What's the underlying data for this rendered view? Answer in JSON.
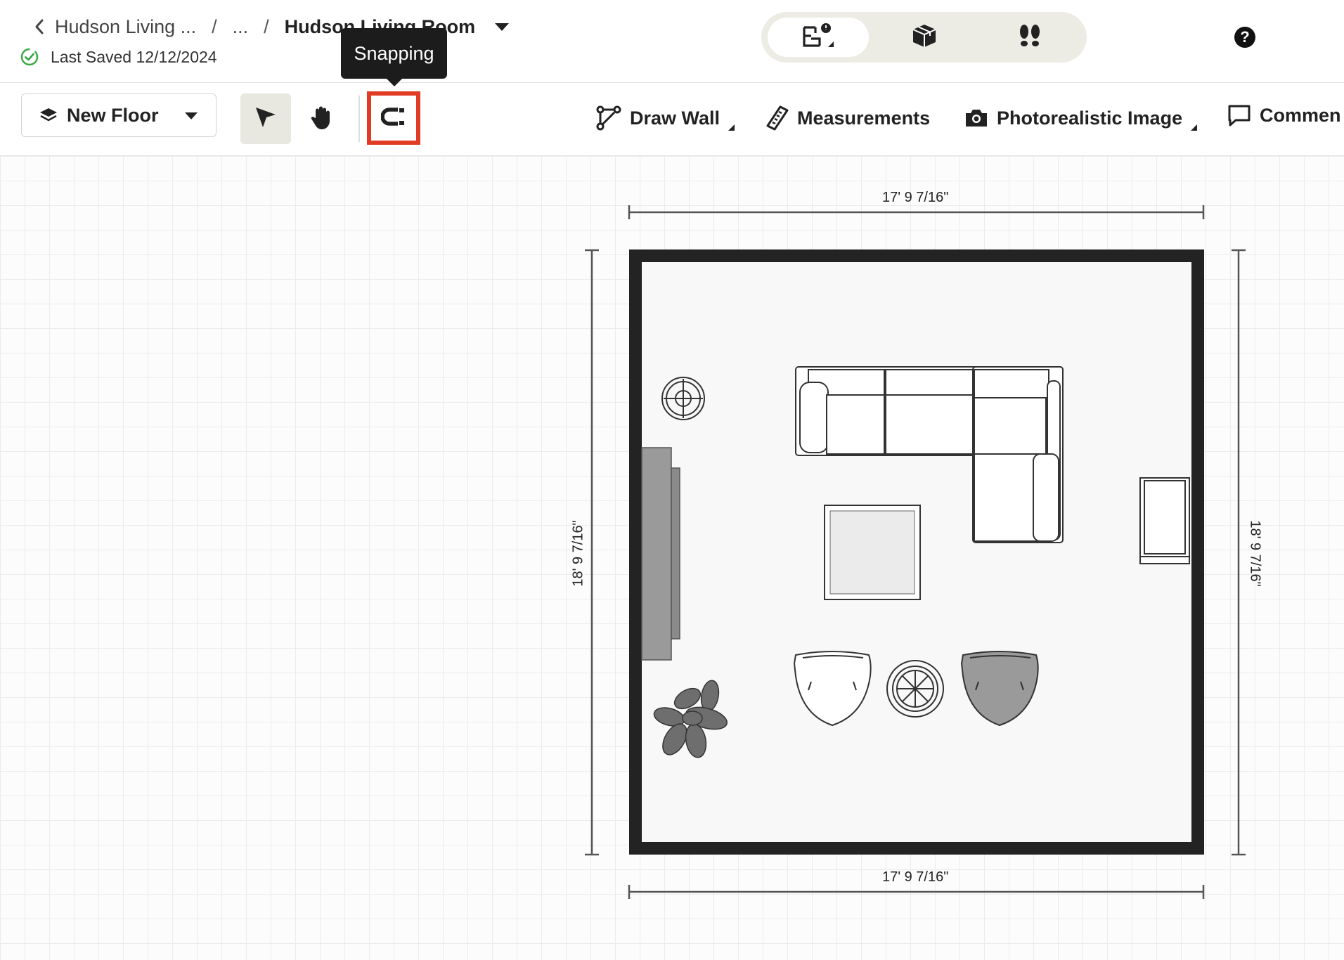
{
  "header": {
    "breadcrumb": {
      "parent": "Hudson Living ...",
      "ellipsis": "...",
      "separator": "/",
      "current": "Hudson Living Room"
    },
    "save_status": "Last Saved 12/12/2024",
    "view_modes": [
      {
        "name": "floorplan-2d-icon",
        "active": true
      },
      {
        "name": "3d-box-icon",
        "active": false
      },
      {
        "name": "walkthrough-footprints-icon",
        "active": false
      }
    ],
    "help_label": "?"
  },
  "toolbar": {
    "floor_select_label": "New Floor",
    "draw_wall_label": "Draw Wall",
    "measurements_label": "Measurements",
    "photorealistic_label": "Photorealistic Image",
    "comments_label": "Commen",
    "tooltip_text": "Snapping"
  },
  "floorplan": {
    "dim_top": "17' 9 7/16\"",
    "dim_bottom": "17' 9 7/16\"",
    "dim_left": "18' 9 7/16\"",
    "dim_right": "18' 9 7/16\""
  },
  "colors": {
    "highlight": "#e23b24",
    "wall": "#232323",
    "segment_bg": "#ecebe4",
    "save_check": "#3aa845"
  }
}
